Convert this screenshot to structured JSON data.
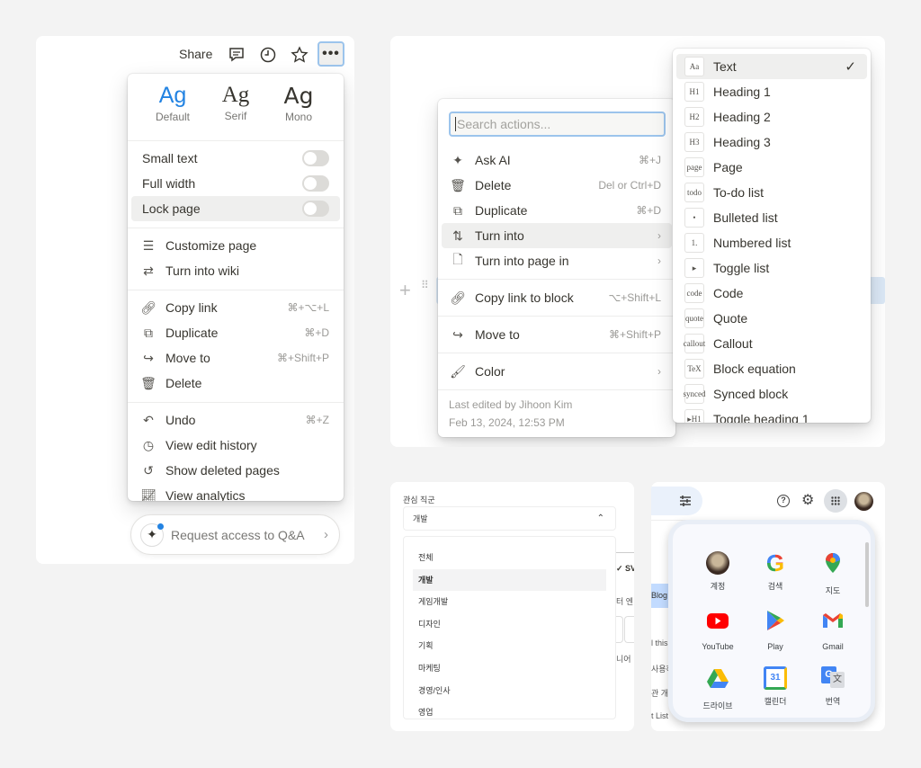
{
  "notion_page_menu": {
    "header": {
      "share": "Share",
      "icons": [
        "comment-icon",
        "clock-icon",
        "star-icon",
        "more-icon"
      ]
    },
    "fonts": [
      {
        "sample": "Ag",
        "label": "Default",
        "selected": true
      },
      {
        "sample": "Ag",
        "label": "Serif"
      },
      {
        "sample": "Ag",
        "label": "Mono"
      }
    ],
    "toggles": [
      {
        "label": "Small text",
        "on": false
      },
      {
        "label": "Full width",
        "on": false
      },
      {
        "label": "Lock page",
        "on": false
      }
    ],
    "group1": [
      {
        "label": "Customize page",
        "icon": "sliders-icon"
      },
      {
        "label": "Turn into wiki",
        "icon": "turn-into-icon"
      }
    ],
    "group2": [
      {
        "label": "Copy link",
        "shortcut": "⌘+⌥+L"
      },
      {
        "label": "Duplicate",
        "shortcut": "⌘+D"
      },
      {
        "label": "Move to",
        "shortcut": "⌘+Shift+P"
      },
      {
        "label": "Delete",
        "shortcut": ""
      }
    ],
    "group3": [
      {
        "label": "Undo",
        "shortcut": "⌘+Z"
      },
      {
        "label": "View edit history",
        "shortcut": ""
      },
      {
        "label": "Show deleted pages",
        "shortcut": ""
      },
      {
        "label": "View analytics",
        "shortcut": ""
      }
    ],
    "request_access": "Request access to Q&A",
    "accent": "#2383e2"
  },
  "block_menu": {
    "search_placeholder": "Search actions...",
    "items": [
      {
        "label": "Ask AI",
        "shortcut": "⌘+J"
      },
      {
        "label": "Delete",
        "shortcut": "Del or Ctrl+D"
      },
      {
        "label": "Duplicate",
        "shortcut": "⌘+D"
      },
      {
        "label": "Turn into",
        "submenu": true
      },
      {
        "label": "Turn into page in",
        "submenu": true
      },
      {
        "label": "Copy link to block",
        "shortcut": "⌥+Shift+L"
      },
      {
        "label": "Move to",
        "shortcut": "⌘+Shift+P"
      },
      {
        "label": "Color",
        "submenu": true
      }
    ],
    "footer": {
      "edited_by": "Last edited by Jihoon Kim",
      "edited_at": "Feb 13, 2024, 12:53 PM"
    },
    "turn_into": [
      {
        "label": "Text",
        "icon": "Aa",
        "selected": true
      },
      {
        "label": "Heading 1",
        "icon": "H1"
      },
      {
        "label": "Heading 2",
        "icon": "H2"
      },
      {
        "label": "Heading 3",
        "icon": "H3"
      },
      {
        "label": "Page",
        "icon": "page"
      },
      {
        "label": "To-do list",
        "icon": "todo"
      },
      {
        "label": "Bulleted list",
        "icon": "•"
      },
      {
        "label": "Numbered list",
        "icon": "1."
      },
      {
        "label": "Toggle list",
        "icon": "▸"
      },
      {
        "label": "Code",
        "icon": "code"
      },
      {
        "label": "Quote",
        "icon": "quote"
      },
      {
        "label": "Callout",
        "icon": "callout"
      },
      {
        "label": "Block equation",
        "icon": "TeX"
      },
      {
        "label": "Synced block",
        "icon": "synced"
      },
      {
        "label": "Toggle heading 1",
        "icon": "▸H1"
      }
    ]
  },
  "job_select": {
    "label": "관심 직군",
    "value": "개발",
    "options": [
      "전체",
      "개발",
      "게임개발",
      "디자인",
      "기획",
      "마케팅",
      "경영/인사",
      "영업"
    ],
    "behind": [
      "✓ SV",
      "터 엔",
      "니어"
    ]
  },
  "google_apps": {
    "apps": [
      {
        "label": "계정"
      },
      {
        "label": "검색"
      },
      {
        "label": "지도"
      },
      {
        "label": "YouTube"
      },
      {
        "label": "Play"
      },
      {
        "label": "Gmail"
      },
      {
        "label": "드라이브"
      },
      {
        "label": "캘린더"
      },
      {
        "label": "번역"
      }
    ],
    "calendar_day": "31",
    "behind": [
      "Blog",
      "l this",
      "사용하",
      "관 개",
      "t List"
    ]
  }
}
